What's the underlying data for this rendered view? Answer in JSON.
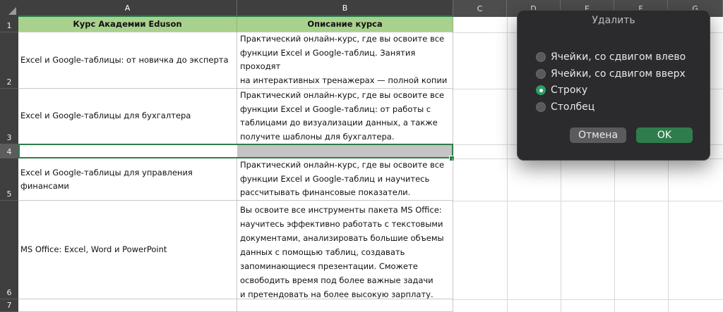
{
  "columns": [
    "A",
    "B",
    "C",
    "D",
    "E",
    "F",
    "G"
  ],
  "rows": [
    "1",
    "2",
    "3",
    "4",
    "5",
    "6",
    "7"
  ],
  "header": {
    "a": "Курс Академии Eduson",
    "b": "Описание курса"
  },
  "courses": [
    {
      "name": "Excel и Google-таблицы: от новичка до эксперта",
      "desc": "Практический онлайн-курс, где вы освоите все\nфункции Excel и Google-таблиц. Занятия проходят\nна интерактивных тренажерах — полной копии\nинтерфейса Microsoft Excel"
    },
    {
      "name": "Excel и Google-таблицы для бухгалтера",
      "desc": "Практический онлайн-курс, где вы освоите все\nфункции Excel и Google-таблиц: от работы с\nтаблицами до визуализации данных, а также\nполучите шаблоны для бухгалтера."
    },
    {
      "name": "Excel и Google-таблицы для управления\nфинансами",
      "desc": "Практический онлайн-курс, где вы освоите все\nфункции Excel и Google-таблиц и научитесь\nрассчитывать финансовые показатели."
    },
    {
      "name": "MS Office: Excel, Word и PowerPoint",
      "desc": "Вы освоите все инструменты пакета MS Office:\nнаучитесь эффективно работать с текстовыми\nдокументами, анализировать большие объемы\nданных с помощью таблиц, создавать\nзапоминающиеся презентации. Сможете\nосвободить время под более важные задачи\nи претендовать на более высокую зарплату."
    }
  ],
  "dialog": {
    "title": "Удалить",
    "options": [
      "Ячейки, со сдвигом влево",
      "Ячейки, со сдвигом вверх",
      "Строку",
      "Столбец"
    ],
    "selected": "Строку",
    "cancel": "Отмена",
    "ok": "OK"
  },
  "colors": {
    "header_fill": "#a9d18e",
    "accent": "#2e7d4a",
    "selected_fill": "#c4c4c4"
  }
}
